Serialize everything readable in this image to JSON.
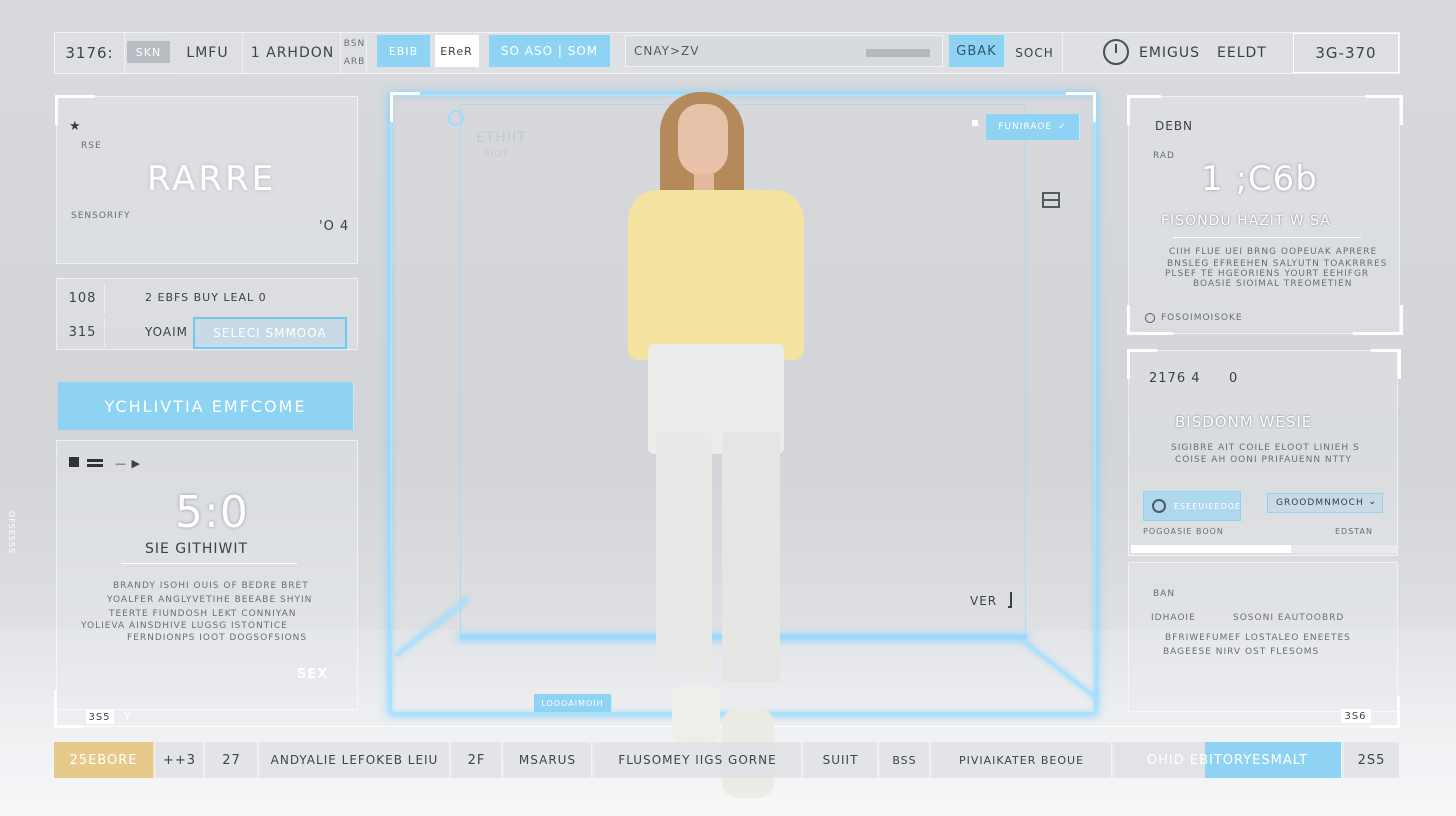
{
  "top_bar": {
    "code_left": "3176:",
    "chip_left": "SKN",
    "label_1": "LMFU",
    "label_2": "1 ARHDON",
    "mini_1": "BSN",
    "mini_2": "ARB",
    "cyan_tab_1": "EBIB",
    "white_tab": "EReR",
    "cyan_tab_2": "SO ASO | SOM",
    "search_value": "CNAY>ZV",
    "search_slider_label": "▬▬▬▬",
    "cyan_button": "GBAK",
    "label_3": "SOCH",
    "timer_label": "EMIGUS",
    "edit_label": "EELDT",
    "code_right": "3G-370"
  },
  "left_top": {
    "small_code": "RSE",
    "title": "RARRE",
    "sub": "SENSORIFY",
    "value": "'O 4"
  },
  "left_mid": {
    "num_1": "108",
    "line_1": "2 EBFS BUY LEAL 0",
    "num_2": "315",
    "label": "YOAIM",
    "button": "SELECI SMMOOA"
  },
  "left_banner": {
    "text": "YCHLIVTIA EMFCOME"
  },
  "left_bottom": {
    "big_value": "5:0",
    "subtitle": "SIE GITHIWIT",
    "para": [
      "BRANDY ISOHI OUIS OF BEDRE BRET",
      "YOALFER ANGLYVETIHE BEEABE SHYIN",
      "TEERTE FIUNDOSH LEKT CONNIYAN",
      "YOLIEVA AINSDHIVE LUGSG ISTONTICE",
      "FERNDIONPS IOOT DOGSOFSIONS"
    ],
    "tag": "SEX"
  },
  "left_foot": {
    "code": "3S5",
    "status": "Y"
  },
  "stage": {
    "ghost_label": "ETHIIT",
    "ghost_sub": "SIOT",
    "badge": "FUNIRAOE",
    "corner_label": "VER",
    "bottom_tag": "LOOOAIMOIH"
  },
  "right_top": {
    "label": "DEBN",
    "sub": "RAD",
    "big_value": "1 ;C6b",
    "title": "FISONDU HAZIT W SA",
    "para": [
      "CIIH FLUE UEI BRNG OOPEUAK APRERE",
      "BNSLEG EFREEHEN SALYUTN TOAKRRRES",
      "PLSEF TE HGEORIENS YOURT EEHIFGR",
      "BOASIE SIOIMAL TREOMETIEN"
    ],
    "foot": "FOSOIMOISOKE"
  },
  "right_mid": {
    "code": "2176 4",
    "value": "0",
    "title": "BISDONM WESIE",
    "para": [
      "SIGIBRE AIT COILE ELOOT LINIEH S",
      "COISE AH OONI PRIFAUENN NTTY"
    ],
    "toggle_label": "ESEEUIEEDOE",
    "select_value": "GROODMNMOCH",
    "foot_left": "POGOASIE BOON",
    "foot_right": "EDSTAN",
    "progress": 0.6
  },
  "right_bottom": {
    "code": "BAN",
    "sub": "IDHAOIE",
    "right_label": "SOSONI EAUTOOBRD",
    "para": [
      "BFRIWEFUMEF LOSTALEO ENEETES",
      "BAGEESE NIRV OST FLESOMS"
    ],
    "foot": "3S6"
  },
  "side_vertical": "OFSESSS",
  "bottom_bar": {
    "cells": [
      "25EBORE",
      "++3",
      "27",
      "ANDYALIE LEFOKEB LEIU",
      "2F",
      "MSARUS",
      "FLUSOMEY IIGS GORNE",
      "SUIIT",
      "BSS",
      "PIVIAIKATER BEOUE",
      "OHID EBITORYESMALT",
      "2S5"
    ]
  },
  "colors": {
    "accent_cyan": "#8fd3f4",
    "glow_cyan": "#78d2ff",
    "accent_tan": "#e8c98c"
  }
}
